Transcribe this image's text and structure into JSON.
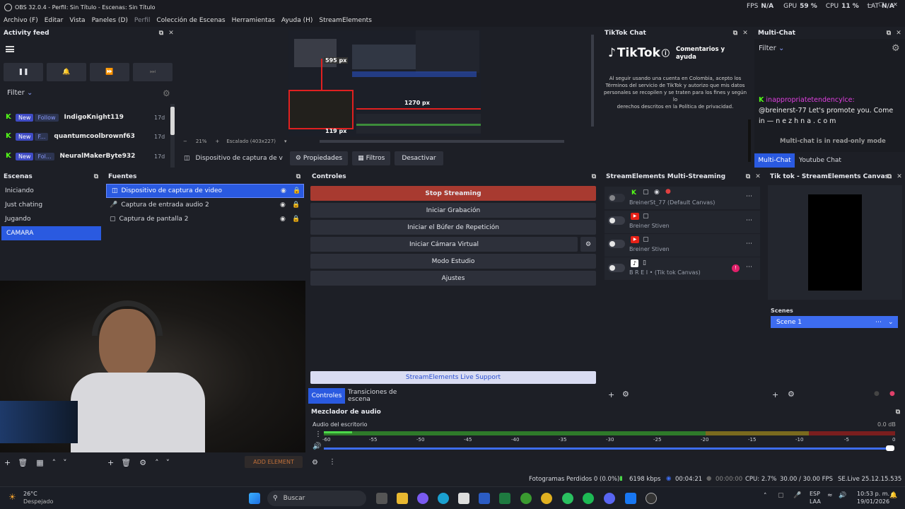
{
  "window": {
    "title": "OBS 32.0.4 - Perfil: Sin Título - Escenas: Sin Título",
    "minimize": "—",
    "maximize": "☐",
    "close": "✕"
  },
  "stats_top": {
    "fps_label": "FPS",
    "fps_value": "N/A",
    "gpu_label": "GPU",
    "gpu_value": "59 %",
    "cpu_label": "CPU",
    "cpu_value": "11 %",
    "lat_label": "LAT",
    "lat_value": "N/A"
  },
  "menu": [
    "Archivo (F)",
    "Editar",
    "Vista",
    "Paneles (D)",
    "Perfil",
    "Colección de Escenas",
    "Herramientas",
    "Ayuda (H)",
    "StreamElements"
  ],
  "activity": {
    "title": "Activity feed",
    "filter": "Filter",
    "items": [
      {
        "tag": "New",
        "action": "Follow",
        "name": "IndigoKnight119",
        "time": "17d"
      },
      {
        "tag": "New",
        "action": "F...",
        "name": "quantumcoolbrownf63",
        "time": "17d"
      },
      {
        "tag": "New",
        "action": "Fol...",
        "name": "NeuralMakerByte932",
        "time": "17d"
      }
    ]
  },
  "preview": {
    "label_595": "595 px",
    "label_1270": "1270 px",
    "label_119": "119 px",
    "zoom": "21%",
    "scale": "Escalado (403x227)",
    "source_name": "Dispositivo de captura de v",
    "props": "Propiedades",
    "filters": "Filtros",
    "deactivate": "Desactivar"
  },
  "tiktok": {
    "title": "TikTok Chat",
    "logo": "TikTok",
    "heading": "Comentarios y ayuda",
    "line1": "Al seguir usando una cuenta en Colombia, acepto los",
    "line2": "Términos del servicio de TikTok y autorizo que mis datos",
    "line3": "personales se recopilen y se traten para los fines y según lo",
    "line4": "derechos descritos en la Política de privacidad."
  },
  "multichat": {
    "title": "Multi-Chat",
    "filter": "Filter",
    "user": "inappropriatetendencylce:",
    "msg1": "@breinerst-77 Let's promote you. Come",
    "msg2": "in — n e z h n a . c o m",
    "readonly": "Multi-chat is in read-only mode",
    "tab1": "Multi-Chat",
    "tab2": "Youtube Chat"
  },
  "scenes": {
    "title": "Escenas",
    "items": [
      "Iniciando",
      "Just chating",
      "Jugando",
      "CAMARA"
    ]
  },
  "sources": {
    "title": "Fuentes",
    "items": [
      "Dispositivo de captura de video",
      "Captura de entrada audio 2",
      "Captura de pantalla 2"
    ],
    "add_element": "ADD ELEMENT"
  },
  "controls": {
    "title": "Controles",
    "stop": "Stop Streaming",
    "record": "Iniciar Grabación",
    "replay": "Iniciar el Búfer de Repetición",
    "vcam": "Iniciar Cámara Virtual",
    "studio": "Modo Estudio",
    "settings": "Ajustes",
    "support": "StreamElements Live Support",
    "tab1": "Controles",
    "tab2": "Transiciones de escena"
  },
  "multistream": {
    "title": "StreamElements Multi-Streaming",
    "items": [
      {
        "name": "BreinerSt_77 (Default Canvas)"
      },
      {
        "name": "Breiner Stiven"
      },
      {
        "name": "Breiner Stiven"
      },
      {
        "name": "B R E I  •  (Tik tok Canvas)"
      }
    ]
  },
  "canvas": {
    "title": "Tik tok - StreamElements Canvas",
    "scenes_label": "Scenes",
    "scene1": "Scene 1"
  },
  "mixer": {
    "title": "Mezclador de audio",
    "track": "Audio del escritorio",
    "db": "0.0 dB",
    "ticks": [
      "-60",
      "-55",
      "-50",
      "-45",
      "-40",
      "-35",
      "-30",
      "-25",
      "-20",
      "-15",
      "-10",
      "-5",
      "0"
    ]
  },
  "status": {
    "dropped": "Fotogramas Perdidos 0 (0.0%)",
    "kbps": "6198 kbps",
    "live_time": "00:04:21",
    "rec_time": "00:00:00",
    "cpu": "CPU: 2.7%",
    "fps": "30.00 / 30.00 FPS",
    "se": "SE.Live 25.12.15.535"
  },
  "taskbar": {
    "temp": "26°C",
    "weather": "Despejado",
    "search": "Buscar",
    "lang1": "ESP",
    "lang2": "LAA",
    "time": "10:53 p. m.",
    "date": "19/01/2026"
  },
  "colors": {
    "accent": "#2a5ae0",
    "stop": "#a83a30",
    "panel": "#1d1f26",
    "button": "#2d303a"
  }
}
